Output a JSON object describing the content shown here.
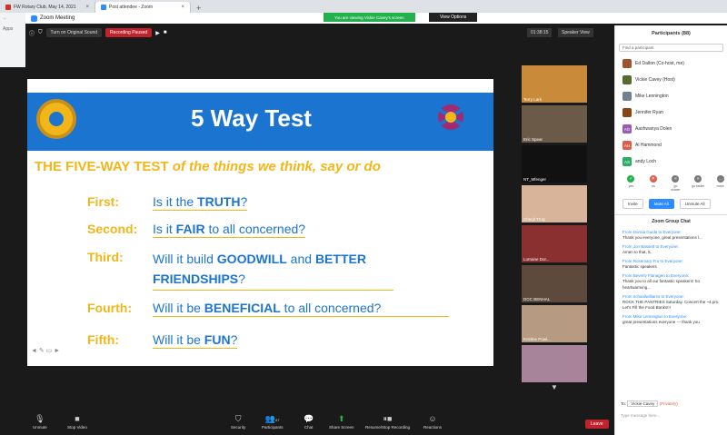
{
  "browser": {
    "tabs": [
      {
        "label": "FW Rotary Club, May 14, 2021",
        "color": "#d93025"
      },
      {
        "label": "Post attendee - Zoom",
        "color": "#2d8cff"
      }
    ],
    "apps_label": "Apps"
  },
  "window": {
    "title": "Zoom Meeting",
    "viewing_banner": "You are viewing Vickie Cavey's screen",
    "view_options": "View Options"
  },
  "topbar": {
    "original_sound": "Turn on Original Sound",
    "recording": "Recording Paused",
    "timer": "01:38:15",
    "speaker_view": "Speaker View"
  },
  "slide": {
    "title": "5 Way Test",
    "subtitle_plain": "THE FIVE-WAY TEST ",
    "subtitle_italic": "of the things we think, say or do",
    "questions": [
      {
        "label": "First:",
        "pre": "Is it the ",
        "bold": "TRUTH",
        "post": "?"
      },
      {
        "label": "Second:",
        "pre": "Is it ",
        "bold": "FAIR",
        "post": " to all concerned?"
      },
      {
        "label": "Third:",
        "pre": "Will it build ",
        "bold": "GOODWILL",
        "mid": " and ",
        "bold2": "BETTER",
        "line2": "FRIENDSHIPS",
        "post": "?"
      },
      {
        "label": "Fourth:",
        "pre": "Will it be ",
        "bold": "BENEFICIAL",
        "post": " to all concerned?"
      },
      {
        "label": "Fifth:",
        "pre": "Will it be ",
        "bold": "FUN",
        "post": "?"
      }
    ]
  },
  "gallery": [
    {
      "name": "Terry Lark",
      "bg": "#c98a3a"
    },
    {
      "name": "Eric Spear",
      "bg": "#6b5a48"
    },
    {
      "name": "NT_Mfenger",
      "bg": "#111111"
    },
    {
      "name": "Cheryl Truly",
      "bg": "#d8b49b"
    },
    {
      "name": "Lorraine Dor...",
      "bg": "#8a3030"
    },
    {
      "name": "DOC BENHAL",
      "bg": "#5d4a3c"
    },
    {
      "name": "Kristine Powl...",
      "bg": "#b69a82"
    },
    {
      "name": "",
      "bg": "#a8849a"
    }
  ],
  "bottombar": {
    "unmute": "Unmute",
    "stop_video": "Stop Video",
    "security": "Security",
    "participants": "Participants",
    "participants_count": "87",
    "chat": "Chat",
    "share": "Share Screen",
    "record": "Resume/Stop Recording",
    "reactions": "Reactions",
    "leave": "Leave"
  },
  "panel": {
    "title": "Participants (88)",
    "find": "Find a participant",
    "participants": [
      {
        "name": "Ed Dalton (Co-host, me)",
        "initials": "",
        "color": "#a0522d"
      },
      {
        "name": "Vickie Cavey (Host)",
        "initials": "",
        "color": "#556b2f"
      },
      {
        "name": "Mike Lennington",
        "initials": "",
        "color": "#708090"
      },
      {
        "name": "Jennifer Ryan",
        "initials": "",
        "color": "#8b4513"
      },
      {
        "name": "Aashwanya Dolen",
        "initials": "AG",
        "color": "#9b59b6"
      },
      {
        "name": "Al Hammond",
        "initials": "AH",
        "color": "#e25c4b"
      },
      {
        "name": "andy Loch",
        "initials": "AS",
        "color": "#27ae60"
      }
    ],
    "reactions": [
      {
        "label": "yes",
        "color": "#23b14d",
        "glyph": "✓"
      },
      {
        "label": "no",
        "color": "#e25c4b",
        "glyph": "✕"
      },
      {
        "label": "go slower",
        "color": "#7a7a7a",
        "glyph": "«"
      },
      {
        "label": "go faster",
        "color": "#7a7a7a",
        "glyph": "»"
      },
      {
        "label": "more",
        "color": "#7a7a7a",
        "glyph": "…"
      }
    ],
    "invite": "Invite",
    "mute_all": "Mute All",
    "unmute_all": "Unmute All",
    "chat_title": "Zoom Group Chat",
    "messages": [
      {
        "from": "From Donna Guida to Everyone:",
        "text": "Thank you everyone, great presentations l..."
      },
      {
        "from": "From Jon Bassett to Everyone:",
        "text": "Amen to that, IL"
      },
      {
        "from": "From Rosemary Fru to Everyone:",
        "text": "Fantastic speakers"
      },
      {
        "from": "From Beverly Flanagen to Everyone:",
        "text": "Thank you to all our fantastic speakers! So heartwarming..."
      },
      {
        "from": "From richardwilliams to Everyone:",
        "text": "ROCK THE PANTRIES Saturday. Concert the ~4 pm.  Let's Fill the Food Banks!!!"
      },
      {
        "from": "From Mike Lennington to Everyone:",
        "text": "great presentations everyone --- thank you"
      }
    ],
    "to_label": "To:",
    "to_value": "Vickie Cavey",
    "private": "(Privately)",
    "input_placeholder": "Type message here..."
  }
}
